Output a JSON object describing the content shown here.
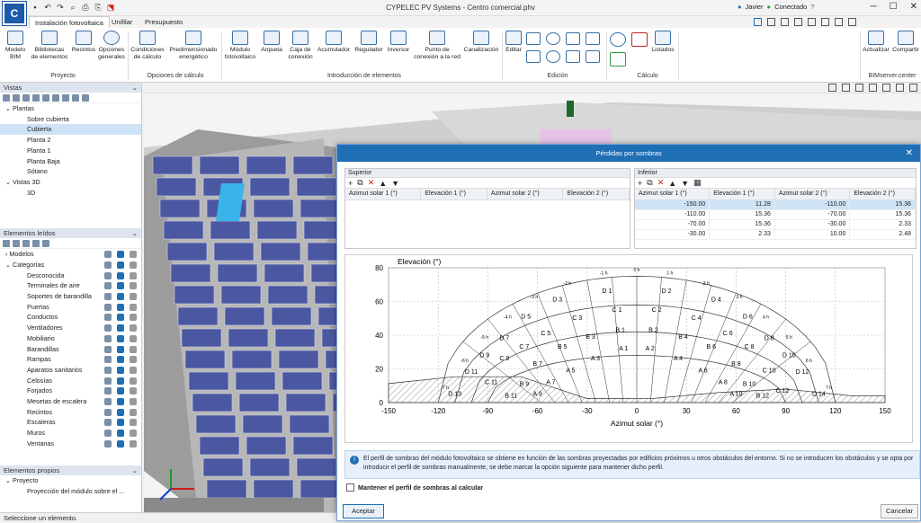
{
  "app": {
    "title": "CYPELEC PV Systems - Centro comercial.phv",
    "logo_text": "C"
  },
  "user": {
    "name": "Javier",
    "status": "Conectado"
  },
  "tabs": [
    "Instalación fotovoltaica",
    "Unifilar",
    "Presupuesto"
  ],
  "ribbon": {
    "buttons": {
      "modelo": "Modelo BIM",
      "bibliotecas": "Bibliotecas de elementos",
      "recintos": "Recintos",
      "opciones": "Opciones generales",
      "condiciones": "Condiciones de cálculo",
      "predim": "Predimensionado energético",
      "modulo": "Módulo fotovoltaico",
      "arqueta": "Arqueta",
      "caja": "Caja de conexión",
      "acumulador": "Acumulador",
      "regulador": "Regulador",
      "inversor": "Inversor",
      "punto": "Punto de conexión a la red",
      "canalizacion": "Canalización",
      "editar": "Editar",
      "listados": "Listados",
      "actualizar": "Actualizar",
      "compartir": "Compartir"
    },
    "groups": {
      "proyecto": "Proyecto",
      "opciones_calc": "Opciones de cálculo",
      "introduccion": "Introducción de elementos",
      "edicion": "Edición",
      "calculo": "Cálculo",
      "bim": "BIMserver.center"
    }
  },
  "vistas": {
    "header": "Vistas",
    "plantas_label": "Plantas",
    "plantas": [
      "Sobre cubierta",
      "Cubierta",
      "Planta 2",
      "Planta 1",
      "Planta Baja",
      "Sótano"
    ],
    "selected": "Cubierta",
    "vistas3d_label": "Vistas 3D",
    "vistas3d": [
      "3D"
    ]
  },
  "elementos": {
    "header": "Elementos leídos",
    "modelos": "Modelos",
    "categorias": "Categorías",
    "items": [
      "Desconocida",
      "Terminales de aire",
      "Soportes de barandilla",
      "Puertas",
      "Conductos",
      "Ventiladores",
      "Mobiliario",
      "Barandillas",
      "Rampas",
      "Aparatos sanitarios",
      "Celosías",
      "Forjados",
      "Mesetas de escalera",
      "Recintos",
      "Escaleras",
      "Muros",
      "Ventanas"
    ]
  },
  "propios": {
    "header": "Elementos propios",
    "proyecto": "Proyecto",
    "item": "Proyección del módulo sobre el ..."
  },
  "status": "Seleccione un elemento.",
  "dialog": {
    "title": "Pérdidas por sombras",
    "superior": {
      "header": "Superior",
      "columns": [
        "Azimut solar 1 (°)",
        "Elevación 1 (°)",
        "Azimut solar 2 (°)",
        "Elevación 2 (°)"
      ]
    },
    "inferior": {
      "header": "Inferior",
      "columns": [
        "Azimut solar 1 (°)",
        "Elevación 1 (°)",
        "Azimut solar 2 (°)",
        "Elevación 2 (°)"
      ],
      "rows": [
        [
          "-150.00",
          "11.28",
          "-110.00",
          "15.36"
        ],
        [
          "-110.00",
          "15.36",
          "-70.00",
          "15.36"
        ],
        [
          "-70.00",
          "15.36",
          "-30.00",
          "2.33"
        ],
        [
          "-30.00",
          "2.33",
          "10.00",
          "2.48"
        ]
      ]
    },
    "info": "El perfil de sombras del módulo fotovoltaico se obtiene en función de las sombras proyectadas por edificios próximos u otros obstáculos del entorno. Si no se introducen los obstáculos y se opta por introducir el perfil de sombras manualmente, se debe marcar la opción siguiente para mantener dicho perfil.",
    "checkbox": "Mantener el perfil de sombras al calcular",
    "accept": "Aceptar",
    "cancel": "Cancelar"
  },
  "chart_data": {
    "type": "area",
    "ylabel": "Elevación (°)",
    "xlabel": "Azimut solar (°)",
    "xlim": [
      -150,
      150
    ],
    "ylim": [
      0,
      80
    ],
    "xticks": [
      -150,
      -120,
      -90,
      -60,
      -30,
      0,
      30,
      60,
      90,
      120,
      150
    ],
    "yticks": [
      0,
      20,
      40,
      60,
      80
    ],
    "grid": true,
    "shadow_profile": {
      "x": [
        -150,
        -110,
        -70,
        -30,
        10,
        50,
        90,
        130,
        150
      ],
      "y": [
        11.28,
        15.36,
        15.36,
        2.33,
        2.48,
        6.0,
        8.0,
        4.0,
        4.0
      ]
    },
    "hour_labels": [
      "0 h",
      "1 h",
      "2 h",
      "3 h",
      "4 h",
      "5 h",
      "6 h",
      "7 h",
      "-1 h",
      "-2 h",
      "-3 h",
      "-4 h",
      "-5 h",
      "-6 h",
      "-7 h"
    ],
    "zones": [
      {
        "id": "D 1",
        "x": -18,
        "y": 65
      },
      {
        "id": "D 2",
        "x": 18,
        "y": 65
      },
      {
        "id": "D 3",
        "x": -48,
        "y": 60
      },
      {
        "id": "D 4",
        "x": 48,
        "y": 60
      },
      {
        "id": "D 5",
        "x": -67,
        "y": 50
      },
      {
        "id": "D 6",
        "x": 67,
        "y": 50
      },
      {
        "id": "D 7",
        "x": -80,
        "y": 37
      },
      {
        "id": "D 8",
        "x": 80,
        "y": 37
      },
      {
        "id": "D 9",
        "x": -92,
        "y": 27
      },
      {
        "id": "D 10",
        "x": 92,
        "y": 27
      },
      {
        "id": "D 11",
        "x": -100,
        "y": 17
      },
      {
        "id": "D 12",
        "x": 100,
        "y": 17
      },
      {
        "id": "D 13",
        "x": -110,
        "y": 4
      },
      {
        "id": "D 14",
        "x": 110,
        "y": 4
      },
      {
        "id": "C 1",
        "x": -12,
        "y": 54
      },
      {
        "id": "C 2",
        "x": 12,
        "y": 54
      },
      {
        "id": "C 3",
        "x": -36,
        "y": 49
      },
      {
        "id": "C 4",
        "x": 36,
        "y": 49
      },
      {
        "id": "C 5",
        "x": -55,
        "y": 40
      },
      {
        "id": "C 6",
        "x": 55,
        "y": 40
      },
      {
        "id": "C 7",
        "x": -68,
        "y": 32
      },
      {
        "id": "C 8",
        "x": 68,
        "y": 32
      },
      {
        "id": "C 9",
        "x": -80,
        "y": 25
      },
      {
        "id": "C 10",
        "x": 80,
        "y": 18
      },
      {
        "id": "C 11",
        "x": -88,
        "y": 11
      },
      {
        "id": "C 12",
        "x": 88,
        "y": 6
      },
      {
        "id": "B 1",
        "x": -10,
        "y": 42
      },
      {
        "id": "B 2",
        "x": 10,
        "y": 42
      },
      {
        "id": "B 3",
        "x": -28,
        "y": 38
      },
      {
        "id": "B 4",
        "x": 28,
        "y": 38
      },
      {
        "id": "B 5",
        "x": -45,
        "y": 32
      },
      {
        "id": "B 6",
        "x": 45,
        "y": 32
      },
      {
        "id": "B 7",
        "x": -60,
        "y": 22
      },
      {
        "id": "B 8",
        "x": 60,
        "y": 22
      },
      {
        "id": "B 9",
        "x": -68,
        "y": 10
      },
      {
        "id": "B 10",
        "x": 68,
        "y": 10
      },
      {
        "id": "B 11",
        "x": -76,
        "y": 3
      },
      {
        "id": "B 12",
        "x": 76,
        "y": 3
      },
      {
        "id": "A 1",
        "x": -8,
        "y": 31
      },
      {
        "id": "A 2",
        "x": 8,
        "y": 31
      },
      {
        "id": "A 3",
        "x": -25,
        "y": 25
      },
      {
        "id": "A 4",
        "x": 25,
        "y": 25
      },
      {
        "id": "A 5",
        "x": -40,
        "y": 18
      },
      {
        "id": "A 6",
        "x": 40,
        "y": 18
      },
      {
        "id": "A 7",
        "x": -52,
        "y": 11
      },
      {
        "id": "A 8",
        "x": 52,
        "y": 11
      },
      {
        "id": "A 9",
        "x": -60,
        "y": 4
      },
      {
        "id": "A 10",
        "x": 60,
        "y": 4
      }
    ]
  },
  "colors": {
    "accent": "#1f6fb5",
    "selection": "#cfe3f7",
    "panel_header": "#dde4ee"
  }
}
